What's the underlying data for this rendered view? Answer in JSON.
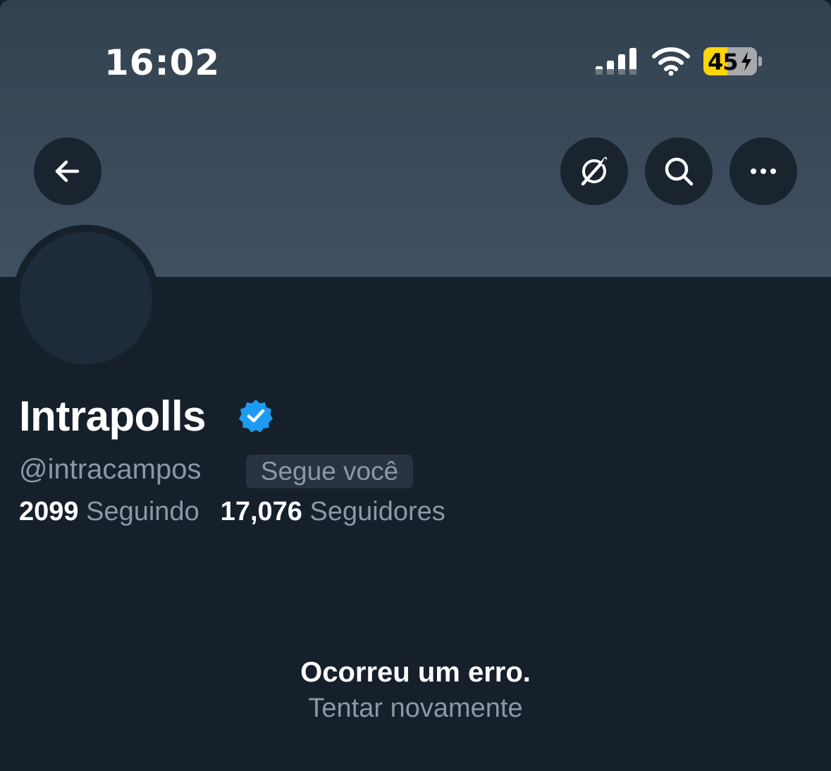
{
  "status_bar": {
    "time": "16:02",
    "battery_level": "45",
    "battery_fill_percent": 45,
    "signal_icon": "cellular-signal-icon",
    "wifi_icon": "wifi-icon",
    "battery_color": "#ffd60a"
  },
  "toolbar": {
    "back_icon": "arrow-left-icon",
    "grok_icon": "grok-icon",
    "search_icon": "search-icon",
    "more_icon": "more-horizontal-icon"
  },
  "profile": {
    "name": "Intrapolls",
    "verified": true,
    "verified_color": "#1d9bf0",
    "handle": "@intracampos",
    "follows_you_label": "Segue você",
    "following_count": "2099",
    "following_label": "Seguindo",
    "followers_count": "17,076",
    "followers_label": "Seguidores"
  },
  "error": {
    "message": "Ocorreu um erro.",
    "retry_label": "Tentar novamente"
  },
  "colors": {
    "background": "#15202b",
    "banner": "#3a4a5b",
    "secondary_text": "#8b98a5"
  }
}
